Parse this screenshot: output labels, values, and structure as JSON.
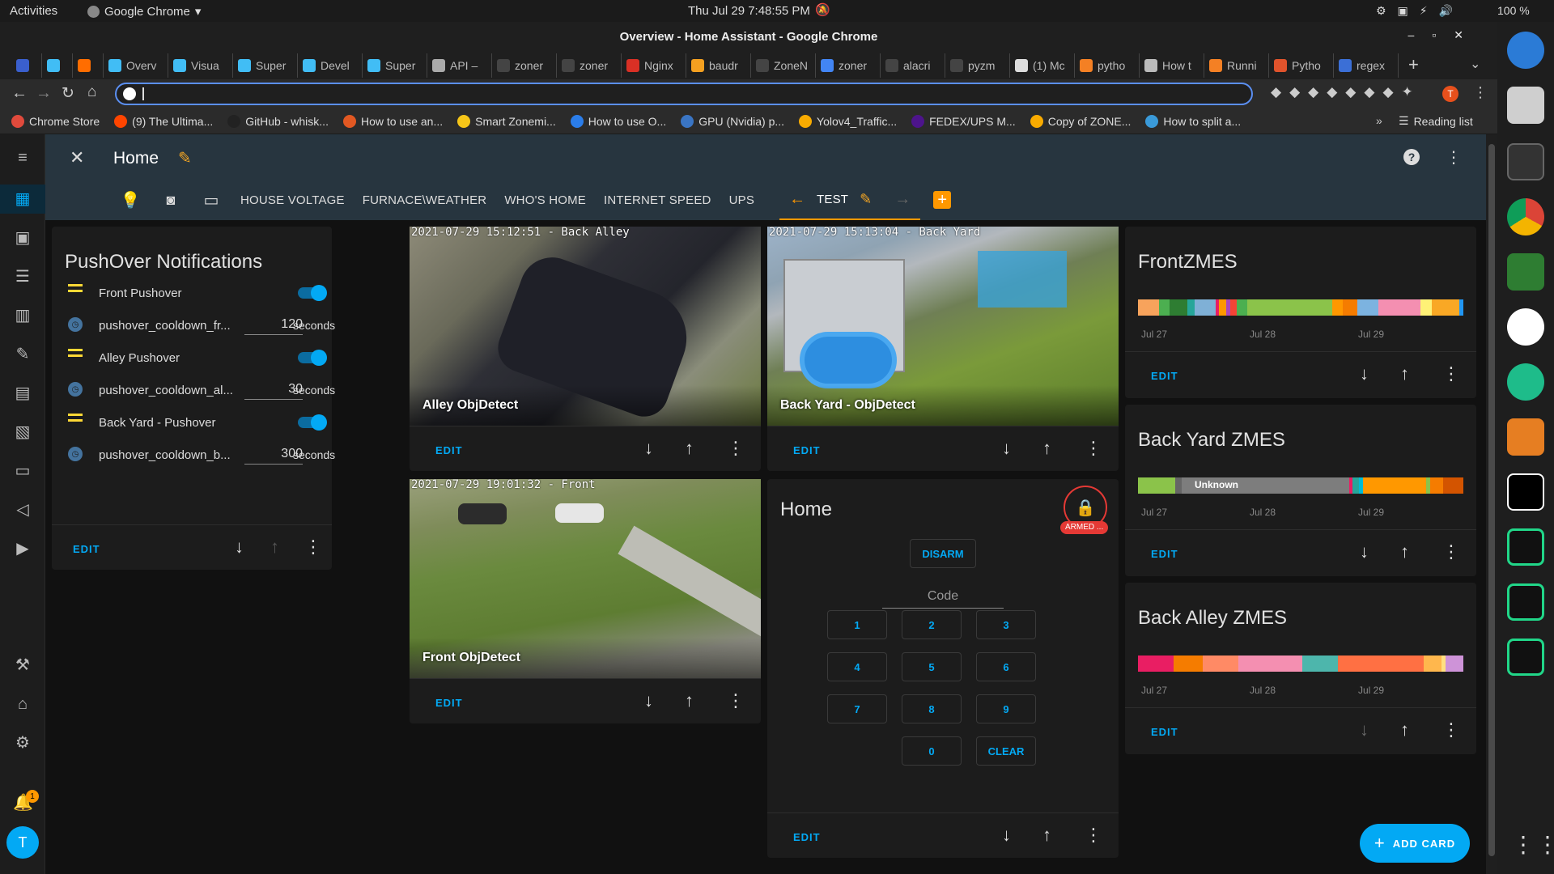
{
  "system": {
    "activities": "Activities",
    "app": "Google Chrome",
    "datetime": "Thu Jul 29  7:48:55 PM",
    "battery": "100 %"
  },
  "window": {
    "title": "Overview - Home Assistant - Google Chrome"
  },
  "tabs": [
    {
      "label": "",
      "color": "#3a5fcd"
    },
    {
      "label": "",
      "color": "#41bdf5"
    },
    {
      "label": "",
      "color": "#ff6d00"
    },
    {
      "label": "Overv",
      "color": "#41bdf5"
    },
    {
      "label": "Visua",
      "color": "#41bdf5"
    },
    {
      "label": "Super",
      "color": "#41bdf5"
    },
    {
      "label": "Devel",
      "color": "#41bdf5"
    },
    {
      "label": "Super",
      "color": "#41bdf5"
    },
    {
      "label": "API –",
      "color": "#aaaaaa"
    },
    {
      "label": "zoner",
      "color": "#444444"
    },
    {
      "label": "zoner",
      "color": "#444444"
    },
    {
      "label": "Nginx",
      "color": "#d93025"
    },
    {
      "label": "baudr",
      "color": "#f4a020"
    },
    {
      "label": "ZoneN",
      "color": "#444444"
    },
    {
      "label": "zoner",
      "color": "#4285f4"
    },
    {
      "label": "alacri",
      "color": "#444444"
    },
    {
      "label": "pyzm",
      "color": "#444444"
    },
    {
      "label": "(1) Mc",
      "color": "#dddddd"
    },
    {
      "label": "pytho",
      "color": "#f48024"
    },
    {
      "label": "How t",
      "color": "#bbbbbb"
    },
    {
      "label": "Runni",
      "color": "#f48024"
    },
    {
      "label": "Pytho",
      "color": "#e0532c"
    },
    {
      "label": "regex",
      "color": "#3b6fd6"
    }
  ],
  "bookmarks": [
    {
      "label": "Chrome Store",
      "color": "#e04a3c"
    },
    {
      "label": "(9) The Ultima...",
      "color": "#ff4500"
    },
    {
      "label": "GitHub - whisk...",
      "color": "#222222"
    },
    {
      "label": "How to use an...",
      "color": "#e25822"
    },
    {
      "label": "Smart Zonemi...",
      "color": "#f5c518"
    },
    {
      "label": "How to use O...",
      "color": "#2b7de9"
    },
    {
      "label": "GPU (Nvidia) p...",
      "color": "#3a75c4"
    },
    {
      "label": "Yolov4_Traffic...",
      "color": "#f9ab00"
    },
    {
      "label": "FEDEX/UPS M...",
      "color": "#4d148c"
    },
    {
      "label": "Copy of ZONE...",
      "color": "#f9ab00"
    },
    {
      "label": "How to split a...",
      "color": "#3a9ad9"
    }
  ],
  "reading_list": "Reading list",
  "header": {
    "title": "Home"
  },
  "nav_tabs": [
    "HOUSE VOLTAGE",
    "FURNACE\\WEATHER",
    "WHO'S HOME",
    "INTERNET SPEED",
    "UPS",
    "TEST"
  ],
  "pushover": {
    "title": "PushOver Notifications",
    "rows": [
      {
        "label": "Front Pushover",
        "type": "toggle",
        "on": true
      },
      {
        "label": "pushover_cooldown_fr...",
        "type": "number",
        "value": "120",
        "unit": "seconds"
      },
      {
        "label": "Alley Pushover",
        "type": "toggle",
        "on": true
      },
      {
        "label": "pushover_cooldown_al...",
        "type": "number",
        "value": "30",
        "unit": "seconds"
      },
      {
        "label": "Back Yard - Pushover",
        "type": "toggle",
        "on": true
      },
      {
        "label": "pushover_cooldown_b...",
        "type": "number",
        "value": "300",
        "unit": "seconds"
      }
    ]
  },
  "cameras": [
    {
      "stamp": "2021-07-29 15:12:51 - Back Alley",
      "caption": "Alley ObjDetect"
    },
    {
      "stamp": "2021-07-29 15:13:04 - Back Yard",
      "caption": "Back Yard - ObjDetect"
    },
    {
      "stamp": "2021-07-29 19:01:32 - Front",
      "caption": "Front ObjDetect"
    }
  ],
  "alarm": {
    "title": "Home",
    "state": "ARMED ...",
    "disarm": "DISARM",
    "code_placeholder": "Code",
    "keys": [
      "1",
      "2",
      "3",
      "4",
      "5",
      "6",
      "7",
      "8",
      "9",
      "0",
      "CLEAR"
    ]
  },
  "history": [
    {
      "title": "FrontZMES",
      "dates": [
        "Jul 27",
        "Jul 28",
        "Jul 29"
      ],
      "segments": [
        [
          "#f7a35c",
          6
        ],
        [
          "#4caf50",
          3
        ],
        [
          "#2e7d32",
          5
        ],
        [
          "#26a69a",
          2
        ],
        [
          "#7fb0d6",
          6
        ],
        [
          "#e91e63",
          1
        ],
        [
          "#ff9800",
          2
        ],
        [
          "#ab47bc",
          1
        ],
        [
          "#f44336",
          2
        ],
        [
          "#4caf50",
          3
        ],
        [
          "#8bc34a",
          24
        ],
        [
          "#ff9800",
          3
        ],
        [
          "#f57c00",
          4
        ],
        [
          "#7cb3e0",
          6
        ],
        [
          "#f48fb1",
          12
        ],
        [
          "#fff176",
          3
        ],
        [
          "#f9a825",
          8
        ],
        [
          "#2196f3",
          1
        ]
      ]
    },
    {
      "title": "Back Yard ZMES",
      "unknown": "Unknown",
      "dates": [
        "Jul 27",
        "Jul 28",
        "Jul 29"
      ],
      "segments": [
        [
          "#8bc34a",
          11
        ],
        [
          "#666666",
          2
        ],
        [
          "#7d7d7d",
          50
        ],
        [
          "#e91e63",
          1
        ],
        [
          "#26a69a",
          2
        ],
        [
          "#00bcd4",
          1
        ],
        [
          "#ff9800",
          19
        ],
        [
          "#8bc34a",
          1
        ],
        [
          "#f57c00",
          4
        ],
        [
          "#d35400",
          6
        ]
      ]
    },
    {
      "title": "Back Alley ZMES",
      "dates": [
        "Jul 27",
        "Jul 28",
        "Jul 29"
      ],
      "segments": [
        [
          "#e91e63",
          10
        ],
        [
          "#f57c00",
          8
        ],
        [
          "#ff8a65",
          10
        ],
        [
          "#f48fb1",
          18
        ],
        [
          "#4db6ac",
          10
        ],
        [
          "#ff7043",
          24
        ],
        [
          "#ffb74d",
          5
        ],
        [
          "#ffe082",
          1
        ],
        [
          "#ce93d8",
          5
        ]
      ]
    }
  ],
  "card_footer": {
    "edit": "EDIT"
  },
  "add_card": "ADD CARD",
  "notification_count": "1",
  "user_initial": "T"
}
